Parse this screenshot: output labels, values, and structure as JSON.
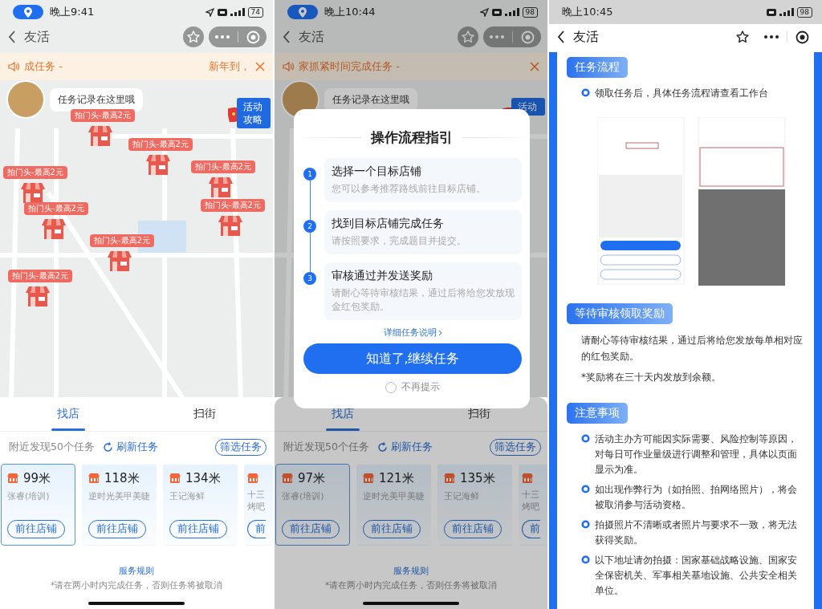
{
  "screens": [
    {
      "kind": "map",
      "status_bar": {
        "time": "晚上9:41",
        "battery": "74",
        "location_indicator": true
      },
      "nav": {
        "title": "友活"
      },
      "notice": {
        "text": "成任务 -",
        "trailing": "新年到，"
      },
      "map": {
        "bubble": "任务记录在这里哦",
        "promo": "活动攻略",
        "markers": [
          "拍门头-最高2元",
          "拍门头-最高2元",
          "拍门头-最高2元",
          "拍门头-最高2元",
          "拍门头-最高2元",
          "拍门头-最高2元",
          "拍门头-最高2元",
          "拍门头-最高2元"
        ]
      },
      "sheet": {
        "tabs": [
          {
            "label": "找店",
            "selected": true
          },
          {
            "label": "扫街",
            "selected": false
          }
        ],
        "summary": "附近发现50个任务",
        "refresh": "刷新任务",
        "filter": "筛选任务",
        "cards": [
          {
            "distance": "99米",
            "name": "张睿(培训)",
            "action": "前往店铺",
            "selected": true
          },
          {
            "distance": "118米",
            "name": "逆时光美甲美睫",
            "action": "前往店铺",
            "selected": false
          },
          {
            "distance": "134米",
            "name": "王记海鲜",
            "action": "前往店铺",
            "selected": false
          },
          {
            "name": "十三烤吧",
            "action": "前",
            "selected": false
          }
        ],
        "rules_link": "服务规则",
        "footnote": "*请在两小时内完成任务，否则任务将被取消"
      }
    },
    {
      "kind": "map",
      "status_bar": {
        "time": "晚上10:44",
        "battery": "98",
        "location_indicator": true
      },
      "nav": {
        "title": "友活"
      },
      "notice": {
        "text": "家抓紧时间完成任务 -"
      },
      "map": {
        "bubble": "任务记录在这里哦",
        "promo": "活动"
      },
      "sheet": {
        "tabs": [
          {
            "label": "找店",
            "selected": true
          },
          {
            "label": "扫街",
            "selected": false
          }
        ],
        "summary": "附近发现50个任务",
        "refresh": "刷新任务",
        "filter": "筛选任务",
        "cards": [
          {
            "distance": "97米",
            "name": "张睿(培训)",
            "action": "前往店铺",
            "selected": true
          },
          {
            "distance": "121米",
            "name": "逆时光美甲美睫",
            "action": "前往店铺",
            "selected": false
          },
          {
            "distance": "135米",
            "name": "王记海鲜",
            "action": "前往店铺",
            "selected": false
          },
          {
            "name": "十三烤吧",
            "action": "前",
            "selected": false
          }
        ],
        "rules_link": "服务规则",
        "footnote": "*请在两小时内完成任务，否则任务将被取消"
      },
      "modal": {
        "title": "操作流程指引",
        "steps": [
          {
            "number": "1",
            "title": "选择一个目标店铺",
            "desc": "您可以参考推荐路线前往目标店铺。"
          },
          {
            "number": "2",
            "title": "找到目标店铺完成任务",
            "desc": "请按照要求，完成题目并提交。"
          },
          {
            "number": "3",
            "title": "审核通过并发送奖励",
            "desc": "请耐心等待审核结果，通过后将给您发放现金红包奖励。"
          }
        ],
        "link": "详细任务说明",
        "button": "知道了,继续任务",
        "opt_out": {
          "label": "不再提示",
          "checked": false
        }
      }
    },
    {
      "kind": "doc",
      "status_bar": {
        "time": "晚上10:45",
        "battery": "98"
      },
      "nav": {
        "title": "友活"
      },
      "sections": [
        {
          "heading": "任务流程",
          "kind": "bullets",
          "items": [
            "领取任务后，具体任务流程请查看工作台"
          ],
          "figure": true
        },
        {
          "heading": "等待审核领取奖励",
          "kind": "paragraphs",
          "items": [
            "请耐心等待审核结果，通过后将给您发放每单相对应的红包奖励。",
            "*奖励将在三十天内发放到余额。"
          ]
        },
        {
          "heading": "注意事项",
          "kind": "bullets",
          "items": [
            "活动主办方可能因实际需要、风险控制等原因，对每日可作业量级进行调整和管理，具体以页面显示为准。",
            "如出现作弊行为（如拍照、拍网络照片），将会被取消参与活动资格。",
            "拍摄照片不清晰或者照片与要求不一致，将无法获得奖励。",
            "以下地址请勿拍摄：国家基础战略设施、国家安全保密机关、军事相关基地设施、公共安全相关单位。"
          ]
        }
      ]
    }
  ]
}
